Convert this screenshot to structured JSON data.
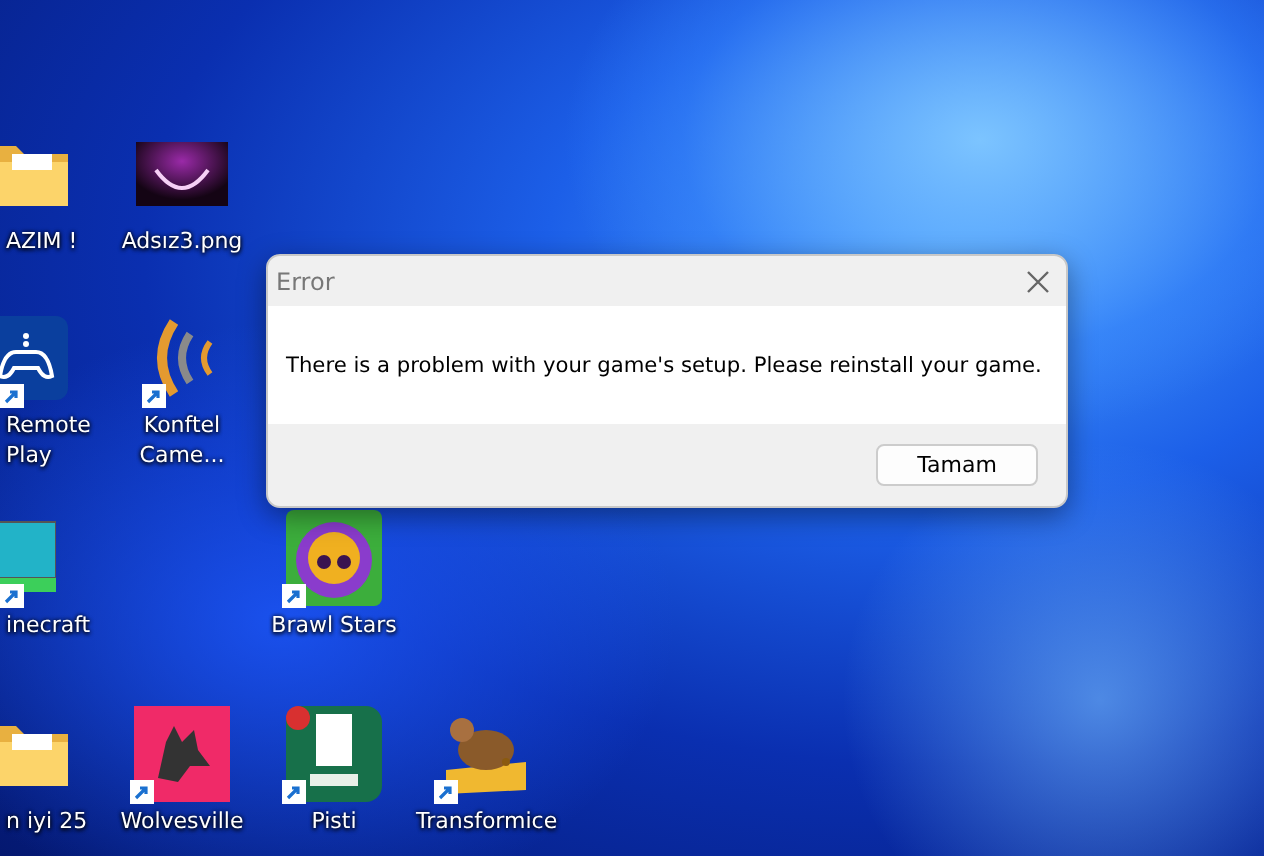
{
  "desktop_icons": [
    {
      "label": "AZIM !",
      "kind": "folder",
      "shortcut": false
    },
    {
      "label": "Adsız3.png",
      "kind": "image",
      "shortcut": false
    },
    {
      "label": "Remote Play",
      "kind": "gamepad",
      "shortcut": true
    },
    {
      "label": "Konftel Came...",
      "kind": "waves",
      "shortcut": true
    },
    {
      "label": "inecraft",
      "kind": "block",
      "shortcut": true
    },
    {
      "label": "Brawl Stars",
      "kind": "skull",
      "shortcut": true
    },
    {
      "label": "n iyi 25",
      "kind": "folder",
      "shortcut": false
    },
    {
      "label": "Wolvesville",
      "kind": "wolf",
      "shortcut": true
    },
    {
      "label": "Pisti",
      "kind": "card",
      "shortcut": true
    },
    {
      "label": "Transformice",
      "kind": "mouse",
      "shortcut": true
    }
  ],
  "dialog": {
    "title": "Error",
    "message": "There is a problem with your game's setup. Please reinstall your game.",
    "buttons": [
      "Tamam"
    ]
  }
}
